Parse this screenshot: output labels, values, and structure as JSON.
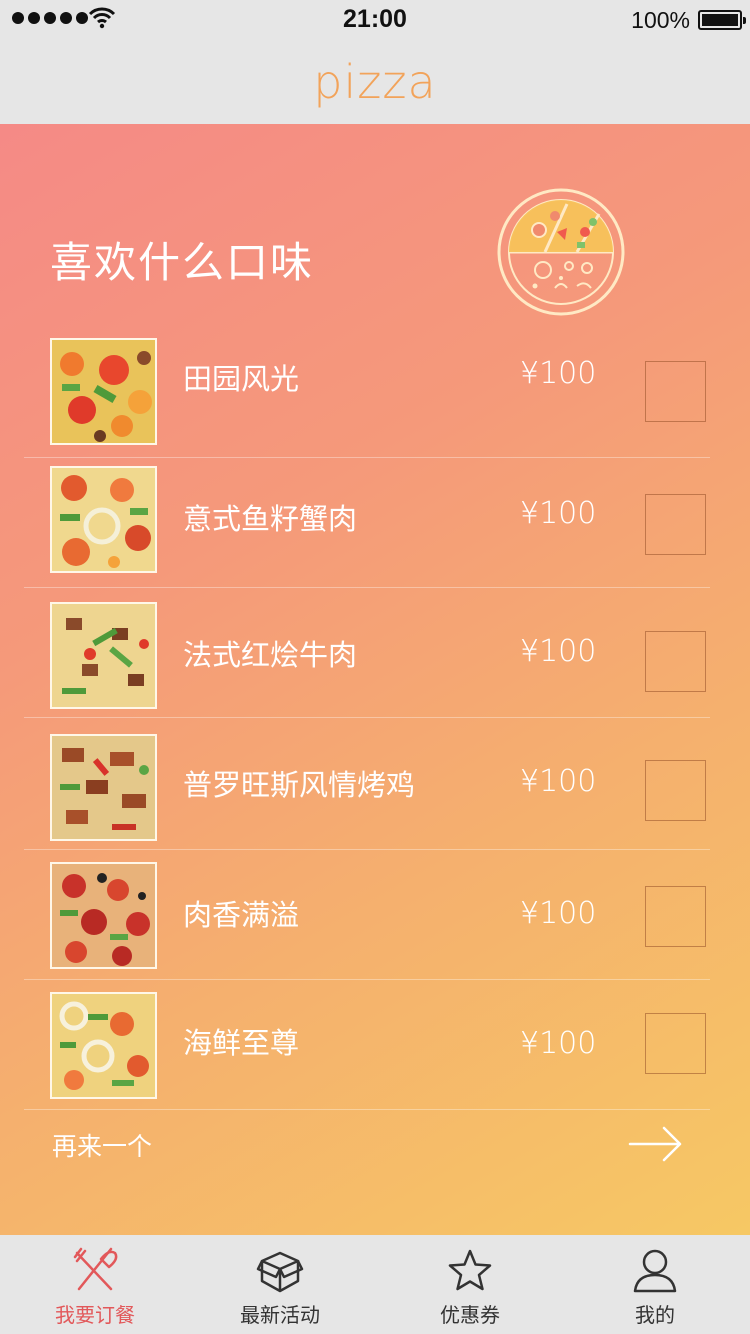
{
  "status_bar": {
    "time": "21:00",
    "battery": "100%"
  },
  "nav": {
    "title": "pizza"
  },
  "heading": "喜欢什么口味",
  "items": [
    {
      "name": "田园风光",
      "price": "¥100"
    },
    {
      "name": "意式鱼籽蟹肉",
      "price": "¥100"
    },
    {
      "name": "法式红烩牛肉",
      "price": "¥100"
    },
    {
      "name": "普罗旺斯风情烤鸡",
      "price": "¥100"
    },
    {
      "name": "肉香满溢",
      "price": "¥100"
    },
    {
      "name": "海鲜至尊",
      "price": "¥100"
    }
  ],
  "more_label": "再来一个",
  "tabs": [
    {
      "label": "我要订餐",
      "icon": "fork-knife-icon",
      "active": true
    },
    {
      "label": "最新活动",
      "icon": "box-icon",
      "active": false
    },
    {
      "label": "优惠券",
      "icon": "star-icon",
      "active": false
    },
    {
      "label": "我的",
      "icon": "user-icon",
      "active": false
    }
  ],
  "colors": {
    "accent": "#e2585a",
    "title": "#f2a35a",
    "gradient_start": "#f58a86",
    "gradient_end": "#f6c864"
  }
}
